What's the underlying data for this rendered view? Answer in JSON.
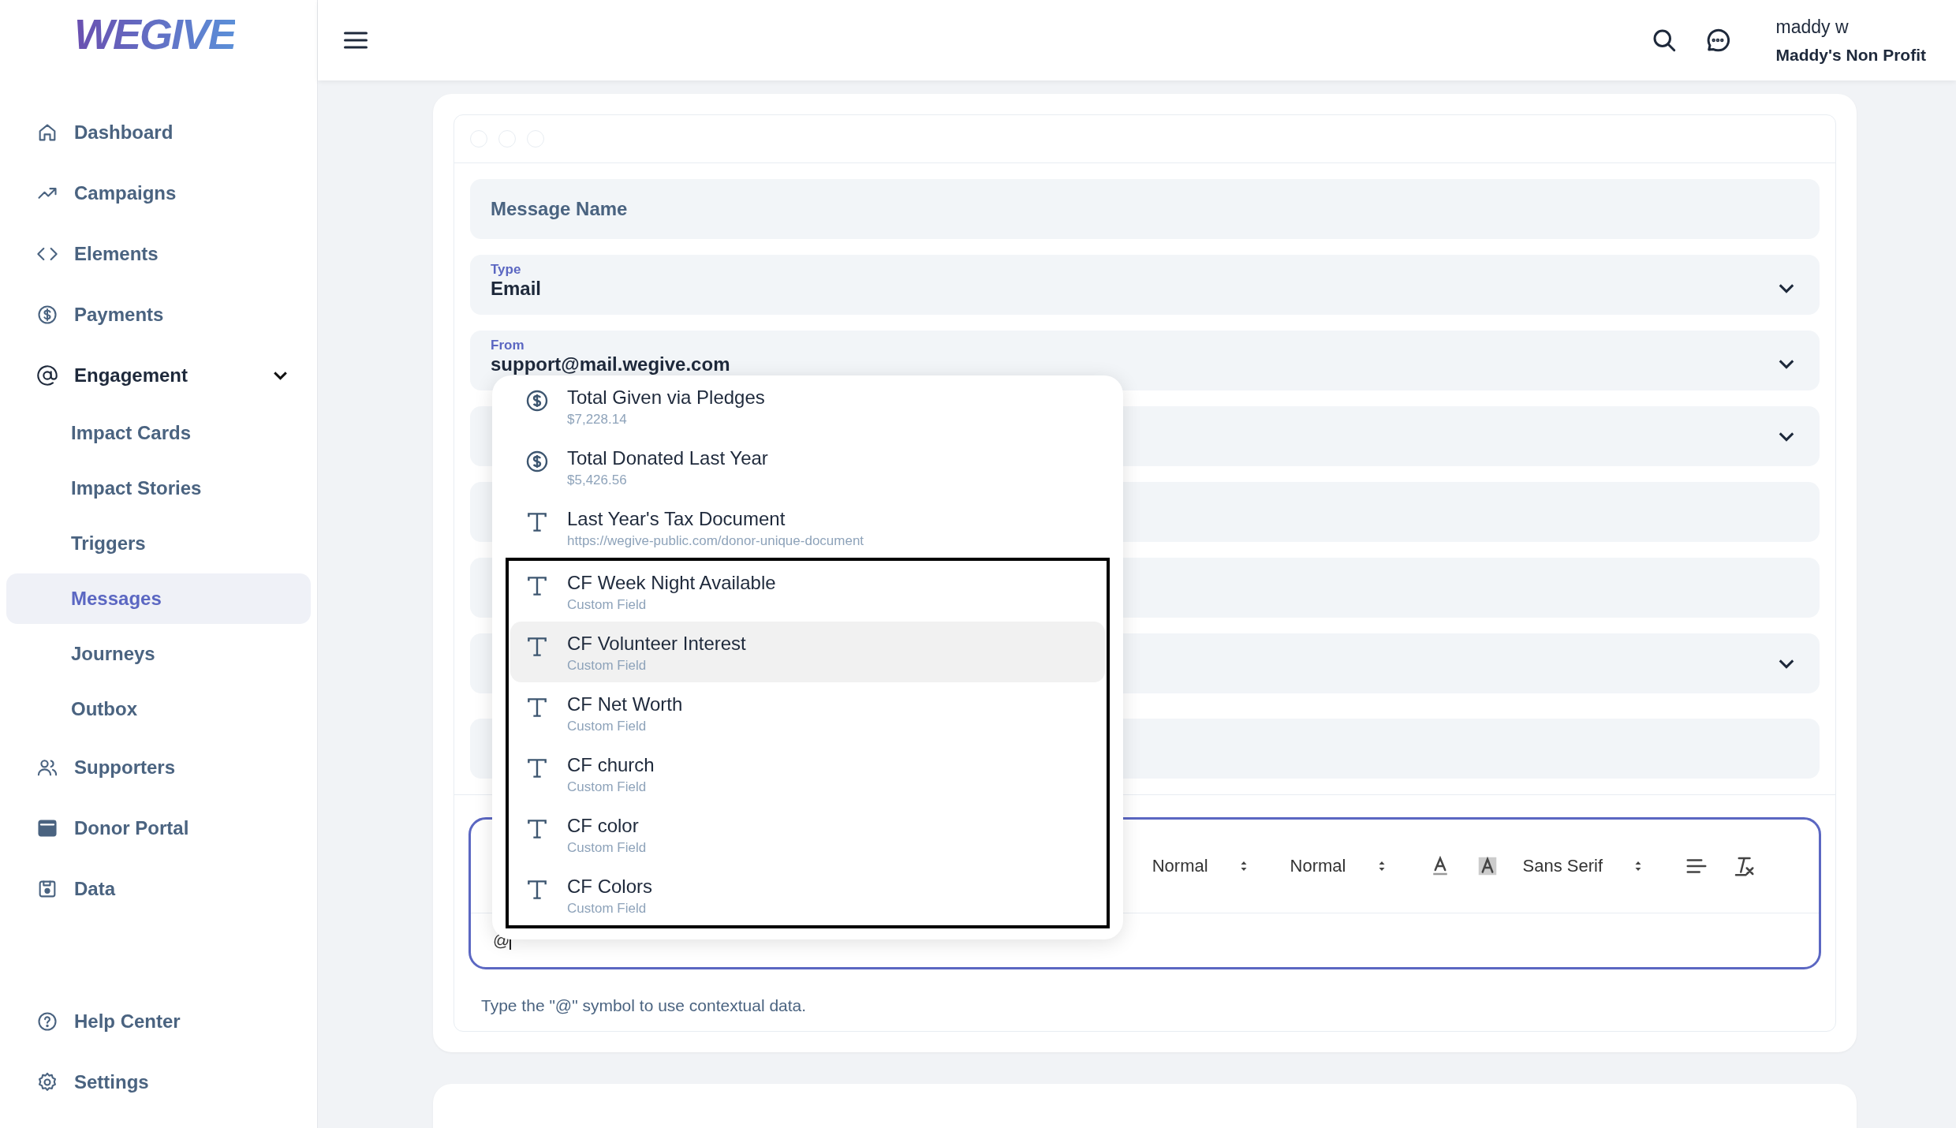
{
  "logo": "WEGIVE",
  "sidebar": {
    "items": [
      {
        "kind": "home",
        "label": "Dashboard",
        "selected": false
      },
      {
        "kind": "trend",
        "label": "Campaigns",
        "selected": false
      },
      {
        "kind": "code",
        "label": "Elements",
        "selected": false
      },
      {
        "kind": "dollar",
        "label": "Payments",
        "selected": false
      },
      {
        "kind": "at",
        "label": "Engagement",
        "selected": false,
        "expanded": true,
        "children": [
          {
            "label": "Impact Cards",
            "selected": false
          },
          {
            "label": "Impact Stories",
            "selected": false
          },
          {
            "label": "Triggers",
            "selected": false
          },
          {
            "label": "Messages",
            "selected": true
          },
          {
            "label": "Journeys",
            "selected": false
          },
          {
            "label": "Outbox",
            "selected": false
          }
        ]
      },
      {
        "kind": "people",
        "label": "Supporters",
        "selected": false
      },
      {
        "kind": "browser",
        "label": "Donor Portal",
        "selected": false
      },
      {
        "kind": "save",
        "label": "Data",
        "selected": false
      }
    ],
    "footer_items": [
      {
        "kind": "help",
        "label": "Help Center",
        "selected": false
      },
      {
        "kind": "gear",
        "label": "Settings",
        "selected": false
      }
    ]
  },
  "header": {
    "user_name": "maddy w",
    "org_name": "Maddy's Non Profit"
  },
  "form": {
    "fields": [
      {
        "kind": "text",
        "placeholder": "Message Name"
      },
      {
        "kind": "select",
        "label": "Type",
        "value": "Email"
      },
      {
        "kind": "select",
        "label": "From",
        "value": "support@mail.wegive.com"
      },
      {
        "kind": "select"
      },
      {
        "kind": "text"
      },
      {
        "kind": "text"
      },
      {
        "kind": "select"
      },
      {
        "kind": "text"
      }
    ]
  },
  "editor": {
    "toolbar": [
      {
        "kind": "select",
        "label": "Normal"
      },
      {
        "kind": "select",
        "label": "Normal"
      },
      {
        "kind": "text-color"
      },
      {
        "kind": "highlight-color"
      },
      {
        "kind": "select",
        "label": "Sans Serif"
      },
      {
        "kind": "align"
      },
      {
        "kind": "clear-format"
      }
    ],
    "value": "@",
    "hint": "Type the \"@\" symbol to use contextual data."
  },
  "mention_menu": {
    "items": [
      {
        "kind": "currency",
        "title": "Total Given via Pledges",
        "detail": "$7,228.14",
        "selected": false,
        "framed": false
      },
      {
        "kind": "currency",
        "title": "Total Donated Last Year",
        "detail": "$5,426.56",
        "selected": false,
        "framed": false
      },
      {
        "kind": "text",
        "title": "Last Year's Tax Document",
        "detail": "https://wegive-public.com/donor-unique-document",
        "selected": false,
        "framed": false
      },
      {
        "kind": "text",
        "title": "CF Week Night Available",
        "detail": "Custom Field",
        "selected": false,
        "framed": true
      },
      {
        "kind": "text",
        "title": "CF Volunteer Interest",
        "detail": "Custom Field",
        "selected": true,
        "framed": true
      },
      {
        "kind": "text",
        "title": "CF Net Worth",
        "detail": "Custom Field",
        "selected": false,
        "framed": true
      },
      {
        "kind": "text",
        "title": "CF church",
        "detail": "Custom Field",
        "selected": false,
        "framed": true
      },
      {
        "kind": "text",
        "title": "CF color",
        "detail": "Custom Field",
        "selected": false,
        "framed": true
      },
      {
        "kind": "text",
        "title": "CF Colors",
        "detail": "Custom Field",
        "selected": false,
        "framed": true
      }
    ]
  }
}
